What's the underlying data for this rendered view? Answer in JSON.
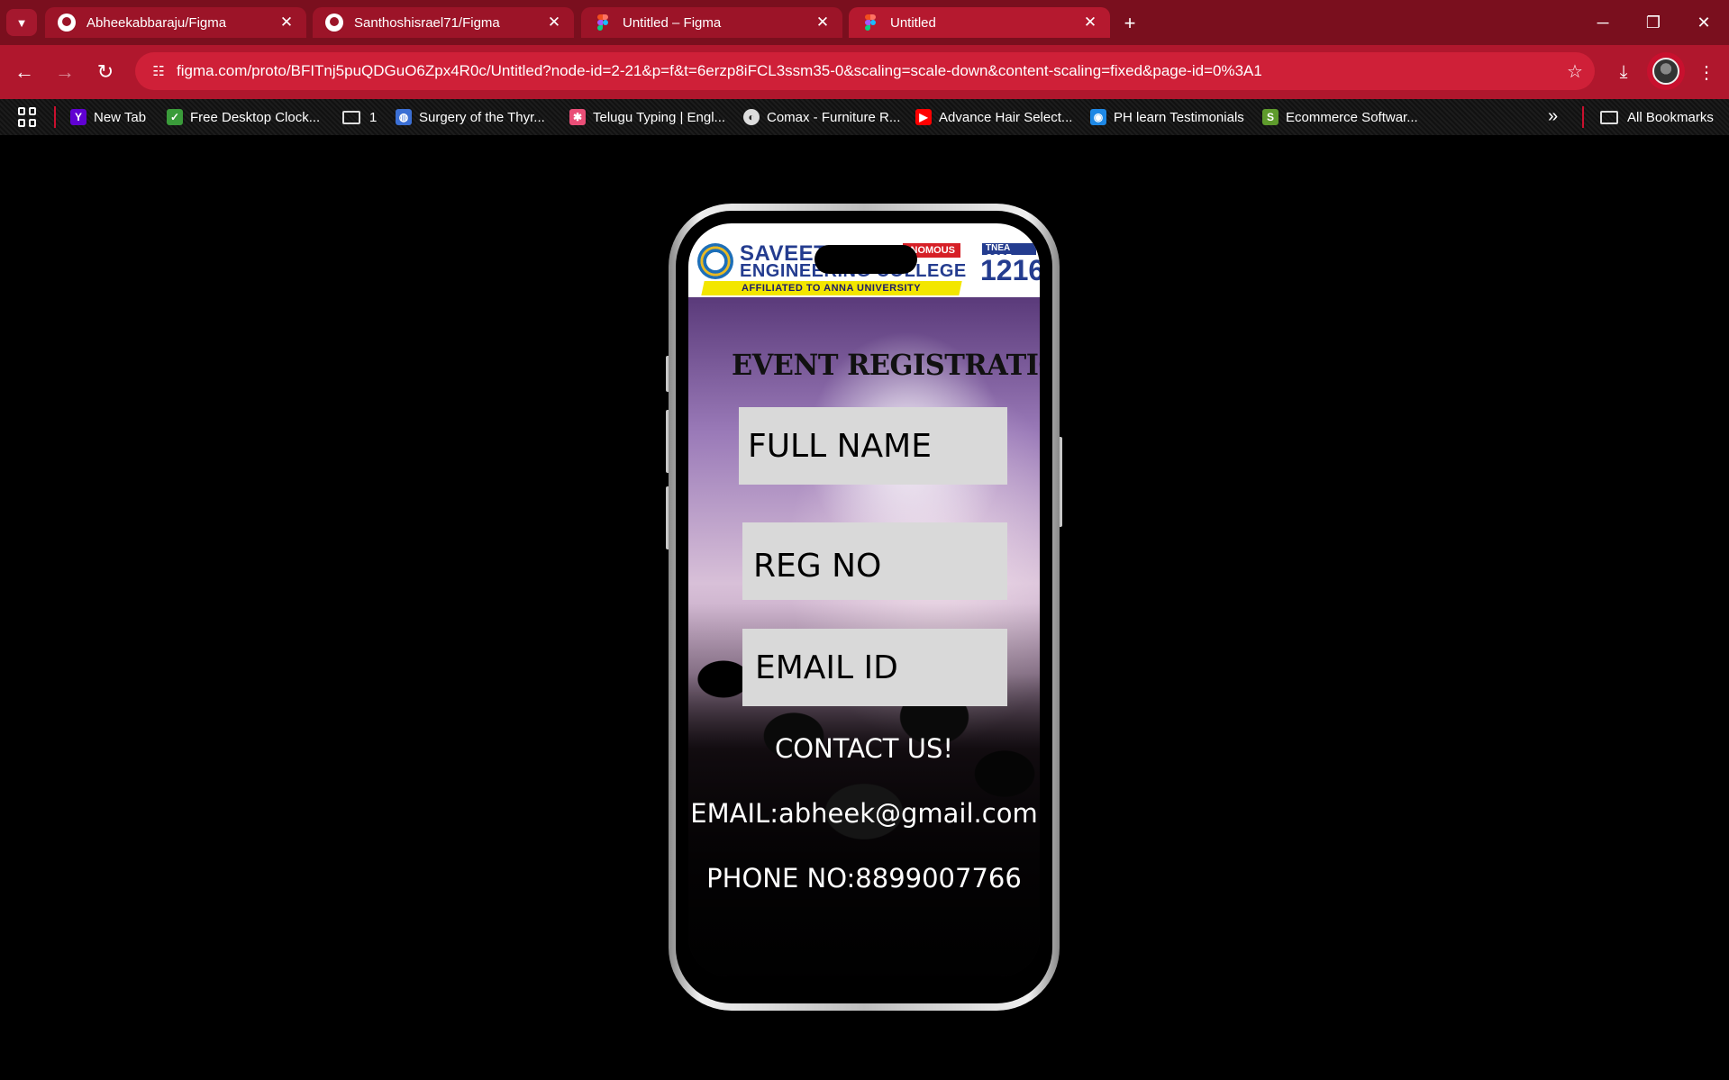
{
  "browser": {
    "tabs": [
      {
        "title": "Abheekabbaraju/Figma",
        "icon": "github-icon"
      },
      {
        "title": "Santhoshisrael71/Figma",
        "icon": "github-icon"
      },
      {
        "title": "Untitled – Figma",
        "icon": "figma-icon"
      },
      {
        "title": "Untitled",
        "icon": "figma-icon",
        "active": true
      }
    ],
    "url": "figma.com/proto/BFITnj5puQDGuO6Zpx4R0c/Untitled?node-id=2-21&p=f&t=6erzp8iFCL3ssm35-0&scaling=scale-down&content-scaling=fixed&page-id=0%3A1",
    "bookmarks": [
      {
        "label": "New Tab",
        "icon": "yahoo-icon",
        "color": "#6001d2"
      },
      {
        "label": "Free Desktop Clock...",
        "icon": "clock-icon",
        "color": "#3a9b3a"
      },
      {
        "label": "1",
        "icon": "folder-icon",
        "color": ""
      },
      {
        "label": "Surgery of the Thyr...",
        "icon": "globe-icon",
        "color": "#3b6fd4"
      },
      {
        "label": "Telugu Typing | Engl...",
        "icon": "puzzle-icon",
        "color": "#e94e77"
      },
      {
        "label": "Comax - Furniture R...",
        "icon": "world-icon",
        "color": "#dddddd"
      },
      {
        "label": "Advance Hair Select...",
        "icon": "youtube-icon",
        "color": "#ff0000"
      },
      {
        "label": "PH learn Testimonials",
        "icon": "camera-icon",
        "color": "#1e88e5"
      },
      {
        "label": "Ecommerce Softwar...",
        "icon": "shopify-icon",
        "color": "#5e9b2c"
      }
    ],
    "all_bookmarks": "All Bookmarks"
  },
  "prototype": {
    "college": {
      "name_line1": "SAVEETHA",
      "name_line2": "ENGINEERING COLLEGE",
      "autonomous": "AUTONOMOUS",
      "affiliated": "AFFILIATED TO ANNA UNIVERSITY",
      "tnea_label": "TNEA CODE",
      "tnea_code": "1216"
    },
    "title": "EVENT REGISTRATION",
    "fields": {
      "full_name": "FULL NAME",
      "reg_no": "REG NO",
      "email_id": "EMAIL ID"
    },
    "contact": {
      "heading": "CONTACT US!",
      "email": "EMAIL:abheek@gmail.com",
      "phone": "PHONE NO:8899007766"
    }
  }
}
